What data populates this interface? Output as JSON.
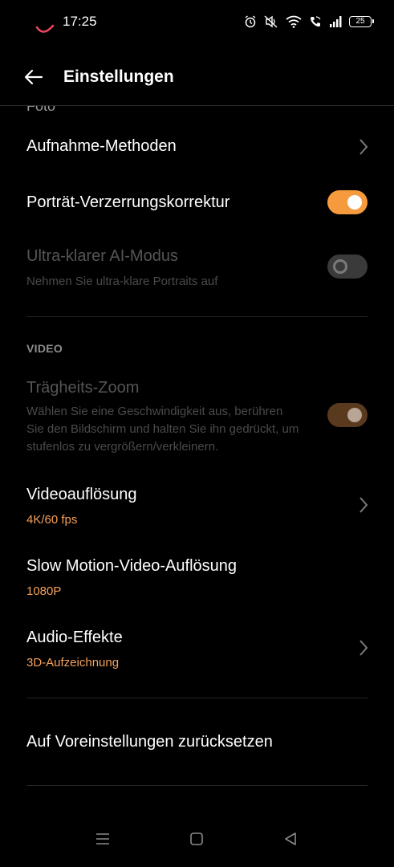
{
  "status_bar": {
    "time": "17:25",
    "battery": "25",
    "icons": [
      "alarm-icon",
      "mute-icon",
      "wifi-icon",
      "wifi-call-icon",
      "signal-icon",
      "battery-icon"
    ]
  },
  "header": {
    "title": "Einstellungen"
  },
  "content": {
    "cut_text": "Foto",
    "capture_methods": {
      "title": "Aufnahme-Methoden"
    },
    "portrait_distortion": {
      "title": "Porträt-Verzerrungskorrektur",
      "enabled": true
    },
    "ultra_clear_ai": {
      "title": "Ultra-klarer AI-Modus",
      "subtitle": "Nehmen Sie ultra-klare Portraits auf",
      "enabled": false
    },
    "video_section": "VIDEO",
    "inertia_zoom": {
      "title": "Trägheits-Zoom",
      "subtitle": "Wählen Sie eine Geschwindigkeit aus, berühren Sie den Bildschirm und halten Sie ihn gedrückt, um stufenlos zu vergrößern/verkleinern.",
      "enabled": true
    },
    "video_resolution": {
      "title": "Videoauflösung",
      "value": "4K/60 fps"
    },
    "slow_motion": {
      "title": "Slow Motion-Video-Auflösung",
      "value": "1080P"
    },
    "audio_effects": {
      "title": "Audio-Effekte",
      "value": "3D-Aufzeichnung"
    },
    "reset": {
      "title": "Auf Voreinstellungen zurücksetzen"
    }
  },
  "colors": {
    "accent": "#f59b3e",
    "value_text": "#f5a15a",
    "background": "#000000"
  }
}
